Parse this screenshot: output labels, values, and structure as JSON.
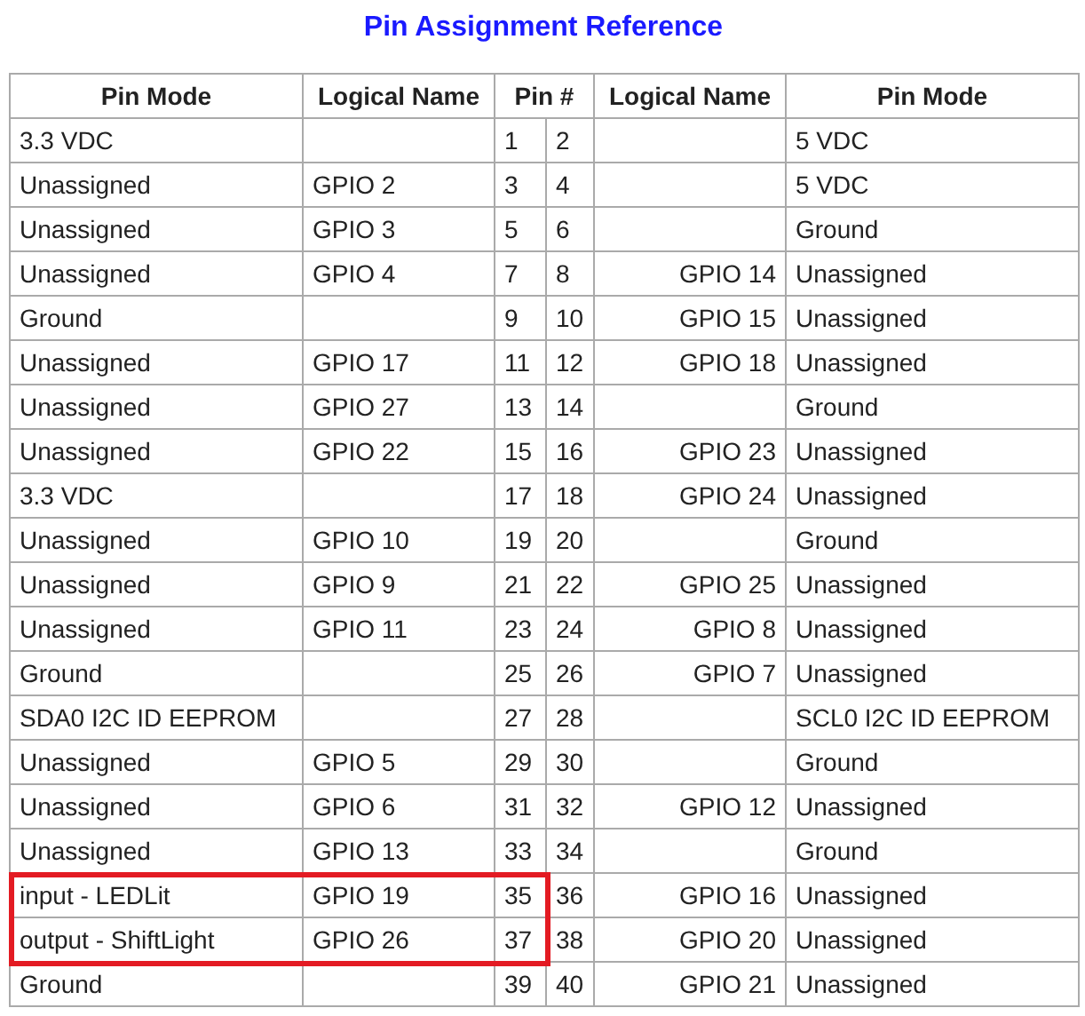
{
  "title": "Pin Assignment Reference",
  "columns": [
    "Pin Mode",
    "Logical Name",
    "Pin #",
    "Logical Name",
    "Pin Mode"
  ],
  "rows": [
    {
      "left_mode": "3.3 VDC",
      "left_pin": "1",
      "right_pin": "2",
      "right_mode": "5 VDC",
      "highlighted": false
    },
    {
      "left_mode": "Unassigned",
      "left_name": "GPIO 2",
      "left_pin": "3",
      "right_pin": "4",
      "right_mode": "5 VDC",
      "highlighted": false
    },
    {
      "left_mode": "Unassigned",
      "left_name": "GPIO 3",
      "left_pin": "5",
      "right_pin": "6",
      "right_mode": "Ground",
      "highlighted": false
    },
    {
      "left_mode": "Unassigned",
      "left_name": "GPIO 4",
      "left_pin": "7",
      "right_pin": "8",
      "right_name": "GPIO 14",
      "right_mode": "Unassigned",
      "highlighted": false
    },
    {
      "left_mode": "Ground",
      "left_pin": "9",
      "right_pin": "10",
      "right_name": "GPIO 15",
      "right_mode": "Unassigned",
      "highlighted": false
    },
    {
      "left_mode": "Unassigned",
      "left_name": "GPIO 17",
      "left_pin": "11",
      "right_pin": "12",
      "right_name": "GPIO 18",
      "right_mode": "Unassigned",
      "highlighted": false
    },
    {
      "left_mode": "Unassigned",
      "left_name": "GPIO 27",
      "left_pin": "13",
      "right_pin": "14",
      "right_mode": "Ground",
      "highlighted": false
    },
    {
      "left_mode": "Unassigned",
      "left_name": "GPIO 22",
      "left_pin": "15",
      "right_pin": "16",
      "right_name": "GPIO 23",
      "right_mode": "Unassigned",
      "highlighted": false
    },
    {
      "left_mode": "3.3 VDC",
      "left_pin": "17",
      "right_pin": "18",
      "right_name": "GPIO 24",
      "right_mode": "Unassigned",
      "highlighted": false
    },
    {
      "left_mode": "Unassigned",
      "left_name": "GPIO 10",
      "left_pin": "19",
      "right_pin": "20",
      "right_mode": "Ground",
      "highlighted": false
    },
    {
      "left_mode": "Unassigned",
      "left_name": "GPIO 9",
      "left_pin": "21",
      "right_pin": "22",
      "right_name": "GPIO 25",
      "right_mode": "Unassigned",
      "highlighted": false
    },
    {
      "left_mode": "Unassigned",
      "left_name": "GPIO 11",
      "left_pin": "23",
      "right_pin": "24",
      "right_name": "GPIO 8",
      "right_mode": "Unassigned",
      "highlighted": false
    },
    {
      "left_mode": "Ground",
      "left_pin": "25",
      "right_pin": "26",
      "right_name": "GPIO 7",
      "right_mode": "Unassigned",
      "highlighted": false
    },
    {
      "left_mode": "SDA0 I2C ID EEPROM",
      "left_pin": "27",
      "right_pin": "28",
      "right_mode": "SCL0 I2C ID EEPROM",
      "highlighted": false
    },
    {
      "left_mode": "Unassigned",
      "left_name": "GPIO 5",
      "left_pin": "29",
      "right_pin": "30",
      "right_mode": "Ground",
      "highlighted": false
    },
    {
      "left_mode": "Unassigned",
      "left_name": "GPIO 6",
      "left_pin": "31",
      "right_pin": "32",
      "right_name": "GPIO 12",
      "right_mode": "Unassigned",
      "highlighted": false
    },
    {
      "left_mode": "Unassigned",
      "left_name": "GPIO 13",
      "left_pin": "33",
      "right_pin": "34",
      "right_mode": "Ground",
      "highlighted": false
    },
    {
      "left_mode": "input - LEDLit",
      "left_name": "GPIO 19",
      "left_pin": "35",
      "right_pin": "36",
      "right_name": "GPIO 16",
      "right_mode": "Unassigned",
      "highlighted": true
    },
    {
      "left_mode": "output - ShiftLight",
      "left_name": "GPIO 26",
      "left_pin": "37",
      "right_pin": "38",
      "right_name": "GPIO 20",
      "right_mode": "Unassigned",
      "highlighted": true
    },
    {
      "left_mode": "Ground",
      "left_pin": "39",
      "right_pin": "40",
      "right_name": "GPIO 21",
      "right_mode": "Unassigned",
      "highlighted": false
    }
  ]
}
